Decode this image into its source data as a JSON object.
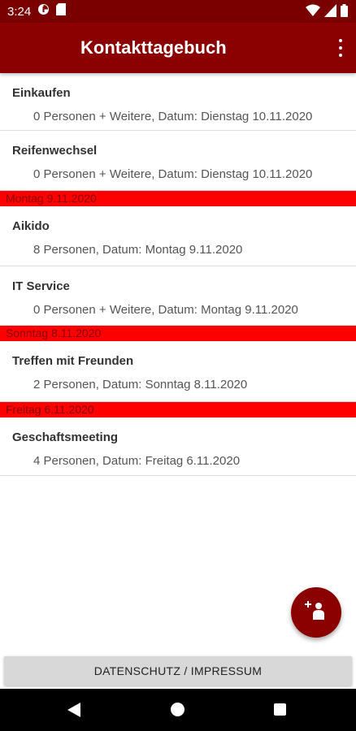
{
  "status_bar": {
    "time": "3:24",
    "icons_left": [
      "data-saver-icon",
      "sd-card-icon"
    ],
    "icons_right": [
      "wifi-icon",
      "signal-icon",
      "battery-icon"
    ]
  },
  "app_bar": {
    "title": "Kontakttagebuch",
    "menu_icon": "overflow-menu-icon"
  },
  "colors": {
    "app_bar": "#8b0000",
    "status_bar": "#7a0000",
    "date_header_bg": "#ff0000",
    "date_header_text": "#8b0000"
  },
  "list": {
    "groups": [
      {
        "header": "",
        "entries": [
          {
            "title": "Einkaufen",
            "detail": "0 Personen + Weitere, Datum:  Dienstag 10.11.2020"
          },
          {
            "title": "Reifenwechsel",
            "detail": "0 Personen + Weitere, Datum:  Dienstag 10.11.2020"
          }
        ]
      },
      {
        "header": "Montag 9.11.2020",
        "entries": [
          {
            "title": "Aikido",
            "detail": "8 Personen, Datum:  Montag 9.11.2020"
          },
          {
            "title": "IT Service",
            "detail": "0 Personen + Weitere, Datum:  Montag 9.11.2020"
          }
        ]
      },
      {
        "header": "Sonntag 8.11.2020",
        "entries": [
          {
            "title": "Treffen mit Freunden",
            "detail": "2 Personen, Datum:  Sonntag 8.11.2020"
          }
        ]
      },
      {
        "header": "Freitag 6.11.2020",
        "entries": [
          {
            "title": "Geschaftsmeeting",
            "detail": "4 Personen, Datum:  Freitag 6.11.2020"
          }
        ]
      }
    ]
  },
  "fab": {
    "icon": "add-person-icon"
  },
  "footer": {
    "button_label": "DATENSCHUTZ / IMPRESSUM"
  },
  "nav_bar": {
    "icons": [
      "back-icon",
      "home-icon",
      "recents-icon"
    ]
  }
}
